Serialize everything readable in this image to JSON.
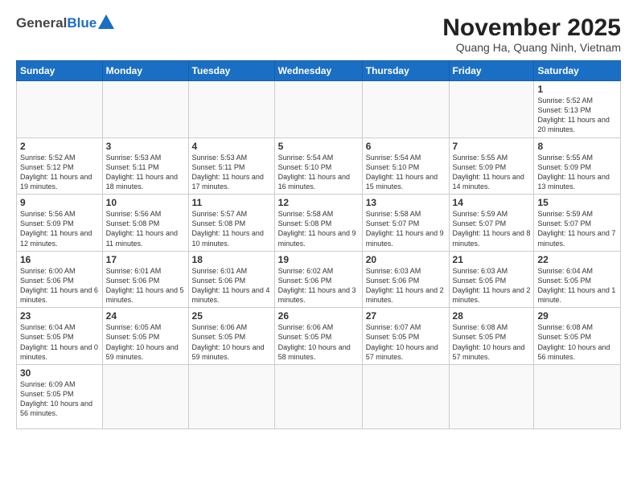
{
  "logo": {
    "general": "General",
    "blue": "Blue"
  },
  "header": {
    "month": "November 2025",
    "location": "Quang Ha, Quang Ninh, Vietnam"
  },
  "weekdays": [
    "Sunday",
    "Monday",
    "Tuesday",
    "Wednesday",
    "Thursday",
    "Friday",
    "Saturday"
  ],
  "weeks": [
    [
      {
        "day": "",
        "info": ""
      },
      {
        "day": "",
        "info": ""
      },
      {
        "day": "",
        "info": ""
      },
      {
        "day": "",
        "info": ""
      },
      {
        "day": "",
        "info": ""
      },
      {
        "day": "",
        "info": ""
      },
      {
        "day": "1",
        "info": "Sunrise: 5:52 AM\nSunset: 5:13 PM\nDaylight: 11 hours and 20 minutes."
      }
    ],
    [
      {
        "day": "2",
        "info": "Sunrise: 5:52 AM\nSunset: 5:12 PM\nDaylight: 11 hours and 19 minutes."
      },
      {
        "day": "3",
        "info": "Sunrise: 5:53 AM\nSunset: 5:11 PM\nDaylight: 11 hours and 18 minutes."
      },
      {
        "day": "4",
        "info": "Sunrise: 5:53 AM\nSunset: 5:11 PM\nDaylight: 11 hours and 17 minutes."
      },
      {
        "day": "5",
        "info": "Sunrise: 5:54 AM\nSunset: 5:10 PM\nDaylight: 11 hours and 16 minutes."
      },
      {
        "day": "6",
        "info": "Sunrise: 5:54 AM\nSunset: 5:10 PM\nDaylight: 11 hours and 15 minutes."
      },
      {
        "day": "7",
        "info": "Sunrise: 5:55 AM\nSunset: 5:09 PM\nDaylight: 11 hours and 14 minutes."
      },
      {
        "day": "8",
        "info": "Sunrise: 5:55 AM\nSunset: 5:09 PM\nDaylight: 11 hours and 13 minutes."
      }
    ],
    [
      {
        "day": "9",
        "info": "Sunrise: 5:56 AM\nSunset: 5:09 PM\nDaylight: 11 hours and 12 minutes."
      },
      {
        "day": "10",
        "info": "Sunrise: 5:56 AM\nSunset: 5:08 PM\nDaylight: 11 hours and 11 minutes."
      },
      {
        "day": "11",
        "info": "Sunrise: 5:57 AM\nSunset: 5:08 PM\nDaylight: 11 hours and 10 minutes."
      },
      {
        "day": "12",
        "info": "Sunrise: 5:58 AM\nSunset: 5:08 PM\nDaylight: 11 hours and 9 minutes."
      },
      {
        "day": "13",
        "info": "Sunrise: 5:58 AM\nSunset: 5:07 PM\nDaylight: 11 hours and 9 minutes."
      },
      {
        "day": "14",
        "info": "Sunrise: 5:59 AM\nSunset: 5:07 PM\nDaylight: 11 hours and 8 minutes."
      },
      {
        "day": "15",
        "info": "Sunrise: 5:59 AM\nSunset: 5:07 PM\nDaylight: 11 hours and 7 minutes."
      }
    ],
    [
      {
        "day": "16",
        "info": "Sunrise: 6:00 AM\nSunset: 5:06 PM\nDaylight: 11 hours and 6 minutes."
      },
      {
        "day": "17",
        "info": "Sunrise: 6:01 AM\nSunset: 5:06 PM\nDaylight: 11 hours and 5 minutes."
      },
      {
        "day": "18",
        "info": "Sunrise: 6:01 AM\nSunset: 5:06 PM\nDaylight: 11 hours and 4 minutes."
      },
      {
        "day": "19",
        "info": "Sunrise: 6:02 AM\nSunset: 5:06 PM\nDaylight: 11 hours and 3 minutes."
      },
      {
        "day": "20",
        "info": "Sunrise: 6:03 AM\nSunset: 5:06 PM\nDaylight: 11 hours and 2 minutes."
      },
      {
        "day": "21",
        "info": "Sunrise: 6:03 AM\nSunset: 5:05 PM\nDaylight: 11 hours and 2 minutes."
      },
      {
        "day": "22",
        "info": "Sunrise: 6:04 AM\nSunset: 5:05 PM\nDaylight: 11 hours and 1 minute."
      }
    ],
    [
      {
        "day": "23",
        "info": "Sunrise: 6:04 AM\nSunset: 5:05 PM\nDaylight: 11 hours and 0 minutes."
      },
      {
        "day": "24",
        "info": "Sunrise: 6:05 AM\nSunset: 5:05 PM\nDaylight: 10 hours and 59 minutes."
      },
      {
        "day": "25",
        "info": "Sunrise: 6:06 AM\nSunset: 5:05 PM\nDaylight: 10 hours and 59 minutes."
      },
      {
        "day": "26",
        "info": "Sunrise: 6:06 AM\nSunset: 5:05 PM\nDaylight: 10 hours and 58 minutes."
      },
      {
        "day": "27",
        "info": "Sunrise: 6:07 AM\nSunset: 5:05 PM\nDaylight: 10 hours and 57 minutes."
      },
      {
        "day": "28",
        "info": "Sunrise: 6:08 AM\nSunset: 5:05 PM\nDaylight: 10 hours and 57 minutes."
      },
      {
        "day": "29",
        "info": "Sunrise: 6:08 AM\nSunset: 5:05 PM\nDaylight: 10 hours and 56 minutes."
      }
    ],
    [
      {
        "day": "30",
        "info": "Sunrise: 6:09 AM\nSunset: 5:05 PM\nDaylight: 10 hours and 56 minutes."
      },
      {
        "day": "",
        "info": ""
      },
      {
        "day": "",
        "info": ""
      },
      {
        "day": "",
        "info": ""
      },
      {
        "day": "",
        "info": ""
      },
      {
        "day": "",
        "info": ""
      },
      {
        "day": "",
        "info": ""
      }
    ]
  ]
}
